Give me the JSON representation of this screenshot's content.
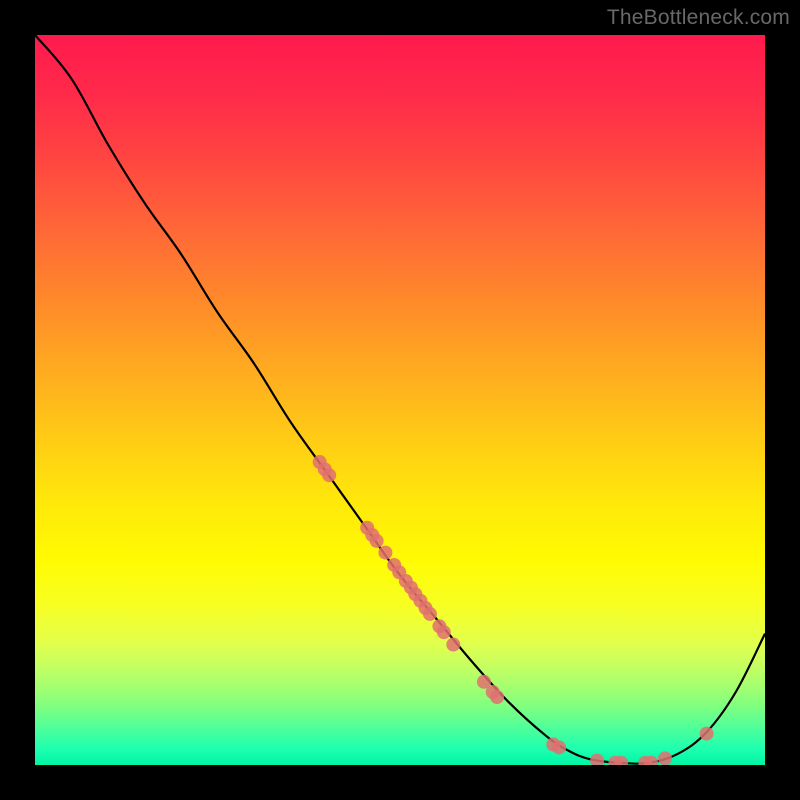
{
  "attribution": "TheBottleneck.com",
  "chart_data": {
    "type": "line",
    "title": "",
    "xlabel": "",
    "ylabel": "",
    "xlim": [
      0,
      100
    ],
    "ylim": [
      0,
      100
    ],
    "grid": false,
    "series": [
      {
        "name": "curve",
        "x": [
          0,
          5,
          10,
          15,
          20,
          25,
          30,
          35,
          40,
          45,
          50,
          55,
          60,
          65,
          70,
          73,
          76,
          80,
          84,
          88,
          92,
          96,
          100
        ],
        "y": [
          100,
          94,
          85,
          77,
          70,
          62,
          55,
          47,
          40,
          33,
          26,
          20,
          14,
          8.5,
          4,
          2,
          0.8,
          0.3,
          0.3,
          1.5,
          4.5,
          10,
          18
        ],
        "color": "#000000",
        "linewidth": 1.4
      }
    ],
    "points": {
      "name": "dots",
      "color": "#e07070",
      "radius": 7,
      "data": [
        {
          "x": 39.0,
          "y": 41.5
        },
        {
          "x": 39.7,
          "y": 40.5
        },
        {
          "x": 40.3,
          "y": 39.7
        },
        {
          "x": 45.5,
          "y": 32.5
        },
        {
          "x": 46.2,
          "y": 31.5
        },
        {
          "x": 46.8,
          "y": 30.7
        },
        {
          "x": 48.0,
          "y": 29.1
        },
        {
          "x": 49.2,
          "y": 27.4
        },
        {
          "x": 49.9,
          "y": 26.4
        },
        {
          "x": 50.8,
          "y": 25.2
        },
        {
          "x": 51.5,
          "y": 24.3
        },
        {
          "x": 52.1,
          "y": 23.4
        },
        {
          "x": 52.8,
          "y": 22.5
        },
        {
          "x": 53.5,
          "y": 21.5
        },
        {
          "x": 54.1,
          "y": 20.7
        },
        {
          "x": 55.4,
          "y": 19.0
        },
        {
          "x": 56.0,
          "y": 18.2
        },
        {
          "x": 57.3,
          "y": 16.5
        },
        {
          "x": 61.5,
          "y": 11.4
        },
        {
          "x": 62.7,
          "y": 10.0
        },
        {
          "x": 63.3,
          "y": 9.3
        },
        {
          "x": 71.0,
          "y": 2.8
        },
        {
          "x": 71.8,
          "y": 2.4
        },
        {
          "x": 77.0,
          "y": 0.6
        },
        {
          "x": 79.5,
          "y": 0.3
        },
        {
          "x": 80.3,
          "y": 0.3
        },
        {
          "x": 83.6,
          "y": 0.3
        },
        {
          "x": 84.4,
          "y": 0.3
        },
        {
          "x": 86.3,
          "y": 0.9
        },
        {
          "x": 92.0,
          "y": 4.3
        }
      ]
    }
  }
}
